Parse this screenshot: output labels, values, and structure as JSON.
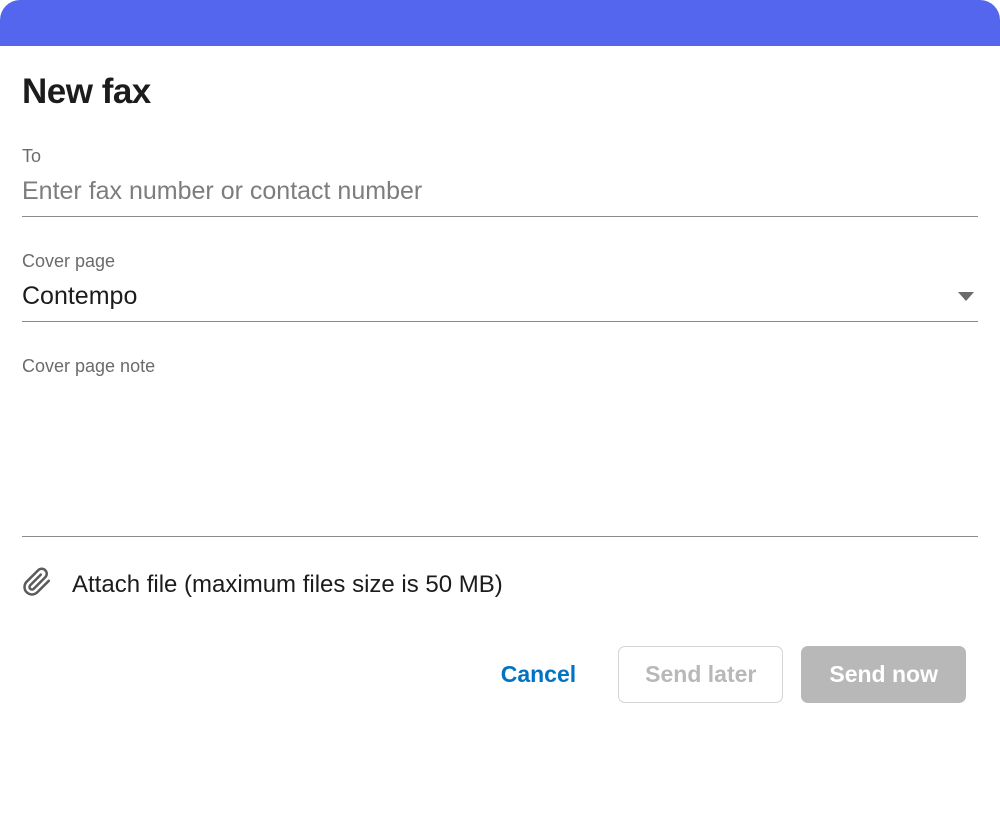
{
  "title": "New fax",
  "to": {
    "label": "To",
    "placeholder": "Enter fax number or contact number",
    "value": ""
  },
  "coverPage": {
    "label": "Cover page",
    "selected": "Contempo"
  },
  "coverPageNote": {
    "label": "Cover page note",
    "value": ""
  },
  "attach": {
    "label": "Attach file (maximum files size is 50 MB)"
  },
  "actions": {
    "cancel": "Cancel",
    "sendLater": "Send later",
    "sendNow": "Send now"
  }
}
